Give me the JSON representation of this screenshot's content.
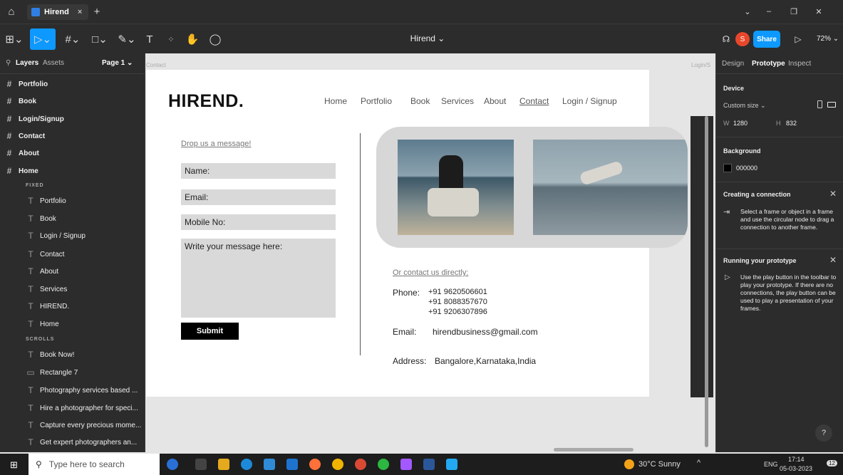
{
  "browser": {
    "tab_title": "Hirend",
    "new_tab": "+",
    "close_tab": "×",
    "controls": [
      "⌄",
      "–",
      "❐",
      "✕"
    ]
  },
  "toolbar": {
    "file_title": "Hirend ⌄",
    "share": "Share",
    "zoom": "72% ⌄",
    "avatar": "S"
  },
  "layers": {
    "tabs": [
      "Layers",
      "Assets"
    ],
    "page": "Page 1 ⌄",
    "frames": [
      "Portfolio",
      "Book",
      "Login/Signup",
      "Contact",
      "About",
      "Home"
    ],
    "section_fixed": "FIXED",
    "fixed": [
      "Portfolio",
      "Book",
      "Login / Signup",
      "Contact",
      "About",
      "Services",
      "HIREND.",
      "Home"
    ],
    "section_scrolls": "SCROLLS",
    "scrolls": [
      "Book Now!",
      "Rectangle 7",
      "Photography services based ...",
      "Hire a photographer for speci...",
      "Capture every precious mome...",
      "Get expert photographers an..."
    ]
  },
  "canvas": {
    "frame_label": "Contact",
    "frame_label_right": "Login/S"
  },
  "site": {
    "logo": "HIREND.",
    "nav": [
      "Home",
      "Portfolio",
      "Book",
      "Services",
      "About",
      "Contact",
      "Login / Signup"
    ],
    "form": {
      "heading": "Drop us a message!",
      "name": "Name:",
      "email": "Email:",
      "mobile": "Mobile No:",
      "message": "Write your message here:",
      "submit": "Submit"
    },
    "contact": {
      "heading": "Or contact us directly:",
      "phone_label": "Phone:",
      "phones": [
        "+91 9620506601",
        "+91 8088357670",
        "+91 9206307896"
      ],
      "email_label": "Email:",
      "email": "hirendbusiness@gmail.com",
      "address_label": "Address:",
      "address": "Bangalore,Karnataka,India"
    }
  },
  "inspector": {
    "tabs": [
      "Design",
      "Prototype",
      "Inspect"
    ],
    "device_title": "Device",
    "device_value": "Custom size ⌄",
    "w_label": "W",
    "w": "1280",
    "h_label": "H",
    "h": "832",
    "bg_title": "Background",
    "bg_value": "000000",
    "conn_title": "Creating a connection",
    "conn_text": "Select a frame or object in a frame and use the circular node to drag a connection to another frame.",
    "run_title": "Running your prototype",
    "run_text": "Use the play button in the toolbar to play your prototype. If there are no connections, the play button can be used to play a presentation of your frames.",
    "help": "?"
  },
  "taskbar": {
    "search": "Type here to search",
    "weather": "30°C  Sunny",
    "lang": "ENG",
    "time": "17:14",
    "date": "05-03-2023",
    "notif": "12"
  },
  "colors": {
    "accent": "#0d99ff",
    "avatar": "#e8472b",
    "panel": "#2c2c2c"
  }
}
